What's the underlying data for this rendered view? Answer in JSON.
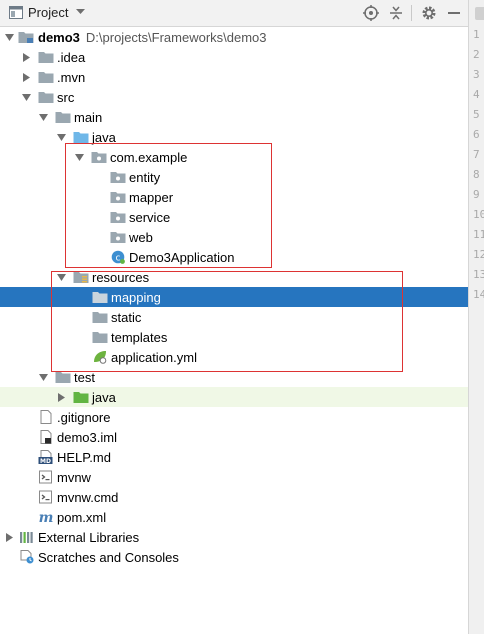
{
  "header": {
    "title": "Project"
  },
  "tree": {
    "root": {
      "label": "demo3",
      "path": "D:\\projects\\Frameworks\\demo3"
    },
    "items": {
      "idea": ".idea",
      "mvn": ".mvn",
      "src": "src",
      "main": "main",
      "java": "java",
      "com_example": "com.example",
      "entity": "entity",
      "mapper": "mapper",
      "service": "service",
      "web": "web",
      "app": "Demo3Application",
      "resources": "resources",
      "mapping": "mapping",
      "static": "static",
      "templates": "templates",
      "app_yml": "application.yml",
      "test": "test",
      "test_java": "java",
      "gitignore": ".gitignore",
      "iml": "demo3.iml",
      "help": "HELP.md",
      "mvnw": "mvnw",
      "mvnw_cmd": "mvnw.cmd",
      "pom": "pom.xml",
      "ext_libs": "External Libraries",
      "scratches": "Scratches and Consoles"
    }
  },
  "gutter": {
    "numbers": [
      "1",
      "2",
      "3",
      "4",
      "5",
      "6",
      "7",
      "8",
      "9",
      "10",
      "11",
      "12",
      "13",
      "14"
    ]
  },
  "colors": {
    "selection": "#2675bf",
    "annotation_box": "#dd3333",
    "folder": "#9aa7b0",
    "source_folder": "#62b543",
    "test_bg": "#f0f8e6"
  }
}
